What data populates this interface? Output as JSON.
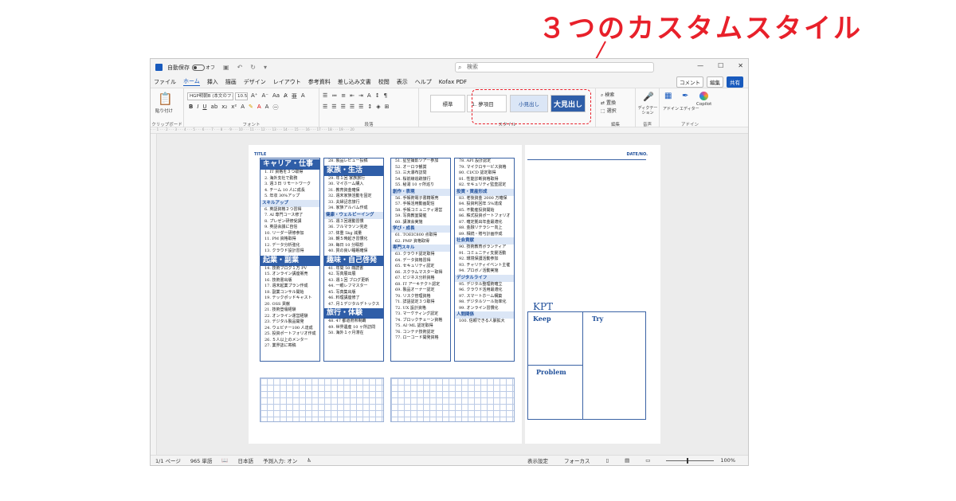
{
  "headline": "３つのカスタムスタイル",
  "titlebar": {
    "autosave": "自動保存",
    "toggle": "オフ",
    "search": "検索",
    "min": "—",
    "max": "☐",
    "close": "✕"
  },
  "menu": [
    "ファイル",
    "ホーム",
    "挿入",
    "描画",
    "デザイン",
    "レイアウト",
    "参考資料",
    "差し込み文書",
    "校閲",
    "表示",
    "ヘルプ",
    "Kofax PDF"
  ],
  "menu_right": {
    "comment": "コメント",
    "edit": "編集",
    "share": "共有"
  },
  "ribbon": {
    "clipboard": {
      "label": "クリップボード",
      "paste": "貼り付け"
    },
    "font": {
      "label": "フォント",
      "name": "HGP明朝B (本文のフォ",
      "size": "10.5"
    },
    "paragraph": {
      "label": "段落"
    },
    "styles": {
      "label": "スタイル",
      "items": [
        "標準",
        "1. 夢項目",
        "小見出し",
        "大見出し"
      ]
    },
    "editing": {
      "label": "編集",
      "items": [
        "検索",
        "置換",
        "選択"
      ]
    },
    "voice": {
      "label": "音声",
      "dictate": "ディクテーション"
    },
    "addin": {
      "label": "アドイン",
      "addin": "アドイン",
      "editor": "エディター",
      "copilot": "Copilot"
    }
  },
  "doc": {
    "title_label": "TITLE",
    "date_label": "DATE/NO.",
    "col1": {
      "h1": "キャリア・仕事",
      "items1": [
        "1. IT 資格を３つ取得",
        "2. 海外支社で勤務",
        "3. 週３日 リモートワーク",
        "4. チーム 10 人に成長",
        "5. 年収 30%アップ"
      ],
      "sub1": "スキルアップ",
      "items2": [
        "6. 英語資格２つ習得",
        "7. AI 専門コース修了",
        "8. プレゼン研修受講",
        "9. 英語会議に自信",
        "10. リーダー研修参加",
        "11. PM 資格取得",
        "12. データ分析強化",
        "13. クラウド設計習得"
      ],
      "h2": "起業・副業",
      "items3": [
        "14. 技術ブログ１万 PV",
        "15. オンライン講座販売",
        "16. 技術書出版",
        "17. 週末起業プラン作成",
        "18. 副業コンサル開始",
        "19. テックポッドキャスト",
        "20. OSS 貢献",
        "21. 技術登壇経験",
        "22. オンライン運営経験",
        "23. デジタル製品開発",
        "24. ウェビナー100 人達成",
        "25. 投資ポートフォリオ作成",
        "26. ５人以上のメンター",
        "27. 業界誌に寄稿"
      ]
    },
    "col2": {
      "items0": [
        "28. 製品レビュー投稿"
      ],
      "h1": "家族・生活",
      "items1": [
        "29. 年１回 家族旅行",
        "30. マイホーム購入",
        "31. 教育資金確保",
        "32. 週末家族活動を固定",
        "33. 夫婦記念旅行",
        "34. 家族アルバム作成"
      ],
      "sub1": "健康・ウェルビーイング",
      "items2": [
        "35. 週３回運動習慣",
        "36. フルマラソン完走",
        "37. 体重 5kg 減量",
        "38. 朝５時起き習慣化",
        "39. 毎日 10 分瞑想",
        "40. 質の良い睡眠確保"
      ],
      "h2": "趣味・自己啓発",
      "items3": [
        "41. 年間 50 冊読書",
        "42. 写真展出展",
        "43. 週１回 ブログ更新",
        "44. 一眼レフマスター",
        "45. 写真集出版",
        "46. 料理講座修了",
        "47. 月１デジタルデトックス"
      ],
      "h3": "旅行・体験",
      "items4": [
        "48. 47 都道府県制覇",
        "49. 世界遺産 10 ヶ所訪問",
        "50. 海外１ヶ月滞在"
      ]
    },
    "col3": {
      "items0": [
        "51. 星空撮影ツアー参加",
        "52. オーロラ観賞",
        "53. 三大瀑布訪問",
        "54. 桜前線追跡旅行",
        "55. 秘湯 10 ヶ所巡り"
      ],
      "sub1": "創作・表現",
      "items1": [
        "56. 手帳術電子書籍販売",
        "57. 手帳活用動画配信",
        "58. 手帳コミュニティ運営",
        "59. 写真教室開催",
        "60. 講演会実施"
      ],
      "sub2": "学び・成長",
      "items2": [
        "61. TOEIC800 点取得",
        "62. PMP 資格取得"
      ],
      "sub3": "専門スキル",
      "items3": [
        "63. クラウド認定取得",
        "64. データ資格習得",
        "65. セキュリティ認定",
        "66. スクラムマスター取得",
        "67. ビジネス分析資格",
        "68. IT アーキテクト認定",
        "69. 製品オーナー認定",
        "70. リスク管理資格",
        "71. 詳語認定３つ取得",
        "72. UX 設計資格",
        "73. マーケティング認定",
        "74. ブロックチェーン資格",
        "75. AI･ML 認定取得",
        "76. コンテナ技術認定",
        "77. ローコード開発資格"
      ]
    },
    "col4": {
      "items0": [
        "78. API 設計認定",
        "79. マイクロサービス資格",
        "80. CI/CD 認定取得",
        "81. 性能診断資格取得",
        "82. セキュリティ監査認定"
      ],
      "sub1": "投資・資産形成",
      "items1": [
        "83. 老後資金 2000 万確保",
        "84. 投資利回年 5%達成",
        "85. 不動産投資開始",
        "86. 株式投資ポートフォリオ",
        "87. 確定拠出年金最適化",
        "88. 金融リテラシー向上",
        "89. 相続・贈与計画作成"
      ],
      "sub2": "社会貢献",
      "items2": [
        "90. 技術教育ボランティア",
        "91. コミュニティ支援活動",
        "92. 環境保護活動参加",
        "93. チャリティイベント主催",
        "94. プロボノ活動実施"
      ],
      "sub3": "デジタルライフ",
      "items3": [
        "95. デジタル整理術確立",
        "96. クラウド活用最適化",
        "97. スマートホーム構築",
        "98. デジタルツール効率化",
        "99. オンライン習慣化"
      ],
      "sub4": "人間関係",
      "items4": [
        "100. 信頼できる人脈拡大"
      ]
    },
    "kpt": {
      "title": "KPT",
      "keep": "Keep",
      "try": "Try",
      "problem": "Problem"
    }
  },
  "status": {
    "page": "1/1 ページ",
    "words": "965 単語",
    "lang": "日本語",
    "input": "予測入力: オン",
    "display": "表示設定",
    "focus": "フォーカス",
    "zoom": "100%"
  }
}
